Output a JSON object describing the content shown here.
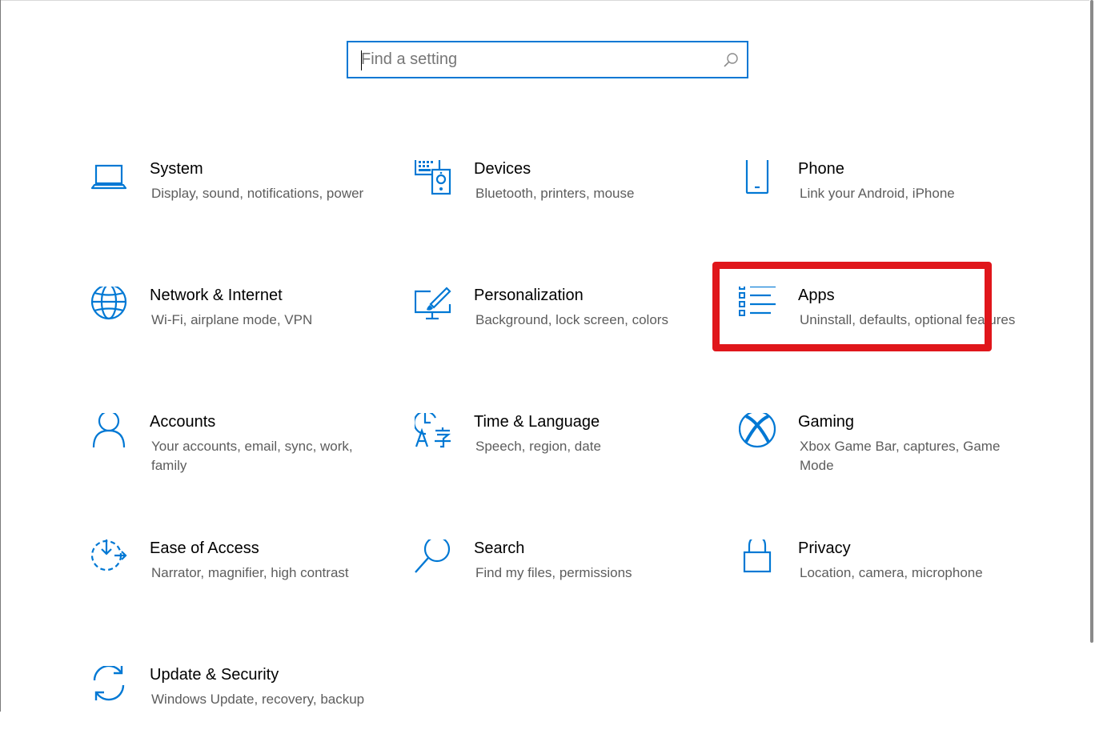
{
  "search": {
    "placeholder": "Find a setting"
  },
  "tiles": [
    {
      "title": "System",
      "desc": "Display, sound, notifications, power",
      "icon": "laptop-icon"
    },
    {
      "title": "Devices",
      "desc": "Bluetooth, printers, mouse",
      "icon": "devices-icon"
    },
    {
      "title": "Phone",
      "desc": "Link your Android, iPhone",
      "icon": "phone-icon"
    },
    {
      "title": "Network & Internet",
      "desc": "Wi-Fi, airplane mode, VPN",
      "icon": "globe-icon"
    },
    {
      "title": "Personalization",
      "desc": "Background, lock screen, colors",
      "icon": "paint-icon"
    },
    {
      "title": "Apps",
      "desc": "Uninstall, defaults, optional features",
      "icon": "apps-list-icon"
    },
    {
      "title": "Accounts",
      "desc": "Your accounts, email, sync, work, family",
      "icon": "person-icon"
    },
    {
      "title": "Time & Language",
      "desc": "Speech, region, date",
      "icon": "time-language-icon"
    },
    {
      "title": "Gaming",
      "desc": "Xbox Game Bar, captures, Game Mode",
      "icon": "xbox-icon"
    },
    {
      "title": "Ease of Access",
      "desc": "Narrator, magnifier, high contrast",
      "icon": "ease-of-access-icon"
    },
    {
      "title": "Search",
      "desc": "Find my files, permissions",
      "icon": "magnifier-icon"
    },
    {
      "title": "Privacy",
      "desc": "Location, camera, microphone",
      "icon": "lock-icon"
    },
    {
      "title": "Update & Security",
      "desc": "Windows Update, recovery, backup",
      "icon": "sync-icon"
    }
  ],
  "colors": {
    "accent": "#0078d4",
    "highlight": "#e0161b",
    "description": "#5d5d5d"
  }
}
